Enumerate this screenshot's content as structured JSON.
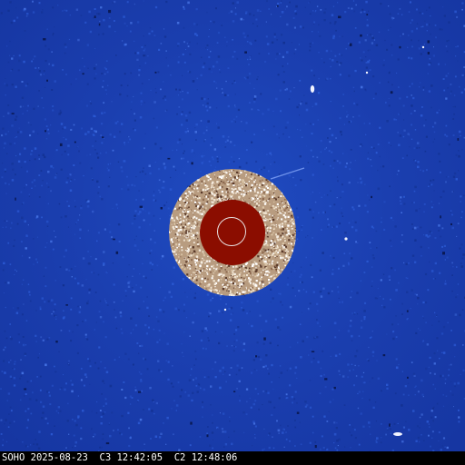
{
  "image": {
    "observatory": "SOHO",
    "date": "2025-08-23",
    "c3_label": "C3",
    "c3_time": "12:42:05",
    "c2_label": "C2",
    "c2_time": "12:48:06"
  },
  "colors": {
    "background": "#1b3fb0",
    "occulter_disk": "#8b0d00",
    "inner_ring": "#d9c9b0",
    "sun_limb": "#e8e0e0",
    "caption_text": "#ffffff",
    "caption_bar": "#000000"
  }
}
